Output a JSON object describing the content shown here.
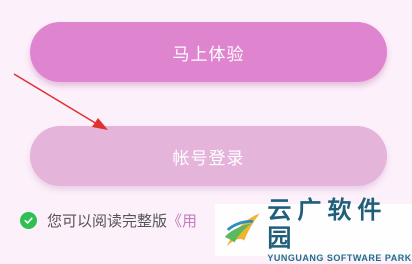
{
  "buttons": {
    "try_now": "马上体验",
    "account_login": "帐号登录"
  },
  "agreement": {
    "prefix": "您可以阅读完整版",
    "link": "《用"
  },
  "watermark": {
    "chinese": "云广软件园",
    "english": "YUNGUANG SOFTWARE PARK"
  },
  "colors": {
    "background": "#fcf0fa",
    "primary_button": "#df85cf",
    "secondary_button": "#e5b4da",
    "check": "#2fc052",
    "arrow": "#e03030"
  },
  "icons": {
    "check": "check-circle-icon",
    "annotation": "red-arrow"
  }
}
